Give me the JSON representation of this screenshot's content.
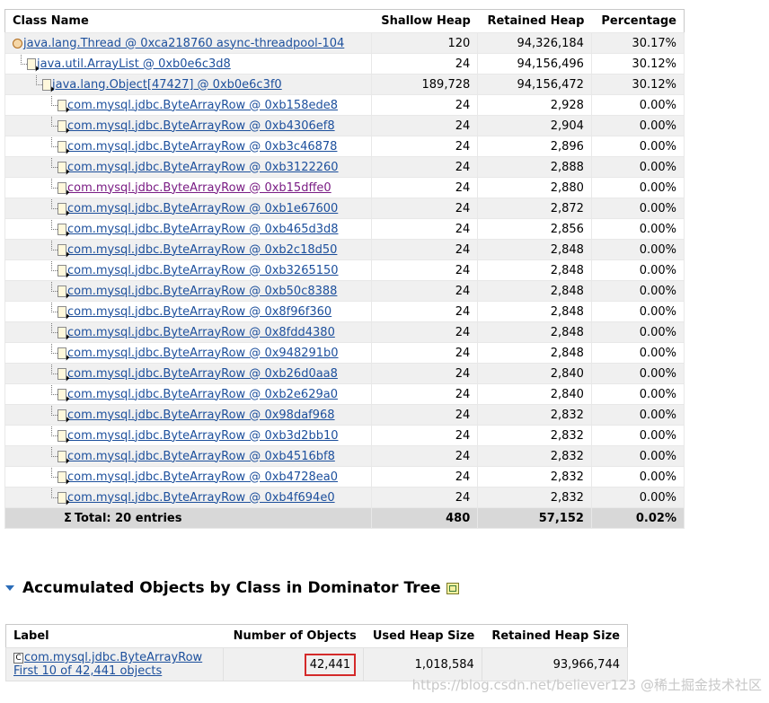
{
  "dominator_table": {
    "columns": [
      "Class Name",
      "Shallow Heap",
      "Retained Heap",
      "Percentage"
    ],
    "rows": [
      {
        "name": "java.lang.Thread @ 0xca218760 async-threadpool-104",
        "shallow": "120",
        "retained": "94,326,184",
        "pct": "30.17%",
        "icon": "thread-icon"
      },
      {
        "name": "java.util.ArrayList @ 0xb0e6c3d8",
        "shallow": "24",
        "retained": "94,156,496",
        "pct": "30.12%",
        "icon": "object-icon"
      },
      {
        "name": "java.lang.Object[47427] @ 0xb0e6c3f0",
        "shallow": "189,728",
        "retained": "94,156,472",
        "pct": "30.12%",
        "icon": "object-icon"
      },
      {
        "name": "com.mysql.jdbc.ByteArrayRow @ 0xb158ede8",
        "shallow": "24",
        "retained": "2,928",
        "pct": "0.00%",
        "icon": "object-icon"
      },
      {
        "name": "com.mysql.jdbc.ByteArrayRow @ 0xb4306ef8",
        "shallow": "24",
        "retained": "2,904",
        "pct": "0.00%",
        "icon": "object-icon"
      },
      {
        "name": "com.mysql.jdbc.ByteArrayRow @ 0xb3c46878",
        "shallow": "24",
        "retained": "2,896",
        "pct": "0.00%",
        "icon": "object-icon"
      },
      {
        "name": "com.mysql.jdbc.ByteArrayRow @ 0xb3122260",
        "shallow": "24",
        "retained": "2,888",
        "pct": "0.00%",
        "icon": "object-icon"
      },
      {
        "name": "com.mysql.jdbc.ByteArrayRow @ 0xb15dffe0",
        "shallow": "24",
        "retained": "2,880",
        "pct": "0.00%",
        "icon": "object-icon"
      },
      {
        "name": "com.mysql.jdbc.ByteArrayRow @ 0xb1e67600",
        "shallow": "24",
        "retained": "2,872",
        "pct": "0.00%",
        "icon": "object-icon"
      },
      {
        "name": "com.mysql.jdbc.ByteArrayRow @ 0xb465d3d8",
        "shallow": "24",
        "retained": "2,856",
        "pct": "0.00%",
        "icon": "object-icon"
      },
      {
        "name": "com.mysql.jdbc.ByteArrayRow @ 0xb2c18d50",
        "shallow": "24",
        "retained": "2,848",
        "pct": "0.00%",
        "icon": "object-icon"
      },
      {
        "name": "com.mysql.jdbc.ByteArrayRow @ 0xb3265150",
        "shallow": "24",
        "retained": "2,848",
        "pct": "0.00%",
        "icon": "object-icon"
      },
      {
        "name": "com.mysql.jdbc.ByteArrayRow @ 0xb50c8388",
        "shallow": "24",
        "retained": "2,848",
        "pct": "0.00%",
        "icon": "object-icon"
      },
      {
        "name": "com.mysql.jdbc.ByteArrayRow @ 0x8f96f360",
        "shallow": "24",
        "retained": "2,848",
        "pct": "0.00%",
        "icon": "object-icon"
      },
      {
        "name": "com.mysql.jdbc.ByteArrayRow @ 0x8fdd4380",
        "shallow": "24",
        "retained": "2,848",
        "pct": "0.00%",
        "icon": "object-icon"
      },
      {
        "name": "com.mysql.jdbc.ByteArrayRow @ 0x948291b0",
        "shallow": "24",
        "retained": "2,848",
        "pct": "0.00%",
        "icon": "object-icon"
      },
      {
        "name": "com.mysql.jdbc.ByteArrayRow @ 0xb26d0aa8",
        "shallow": "24",
        "retained": "2,840",
        "pct": "0.00%",
        "icon": "object-icon"
      },
      {
        "name": "com.mysql.jdbc.ByteArrayRow @ 0xb2e629a0",
        "shallow": "24",
        "retained": "2,840",
        "pct": "0.00%",
        "icon": "object-icon"
      },
      {
        "name": "com.mysql.jdbc.ByteArrayRow @ 0x98daf968",
        "shallow": "24",
        "retained": "2,832",
        "pct": "0.00%",
        "icon": "object-icon"
      },
      {
        "name": "com.mysql.jdbc.ByteArrayRow @ 0xb3d2bb10",
        "shallow": "24",
        "retained": "2,832",
        "pct": "0.00%",
        "icon": "object-icon"
      },
      {
        "name": "com.mysql.jdbc.ByteArrayRow @ 0xb4516bf8",
        "shallow": "24",
        "retained": "2,832",
        "pct": "0.00%",
        "icon": "object-icon"
      },
      {
        "name": "com.mysql.jdbc.ByteArrayRow @ 0xb4728ea0",
        "shallow": "24",
        "retained": "2,832",
        "pct": "0.00%",
        "icon": "object-icon"
      },
      {
        "name": "com.mysql.jdbc.ByteArrayRow @ 0xb4f694e0",
        "shallow": "24",
        "retained": "2,832",
        "pct": "0.00%",
        "icon": "object-icon"
      }
    ],
    "total": {
      "symbol": "Σ",
      "label": "Total: 20 entries",
      "shallow": "480",
      "retained": "57,152",
      "pct": "0.02%"
    }
  },
  "accumulated_section": {
    "title": "Accumulated Objects by Class in Dominator Tree",
    "columns": [
      "Label",
      "Number of Objects",
      "Used Heap Size",
      "Retained Heap Size"
    ],
    "row": {
      "class_icon_glyph": "C",
      "class_name": "com.mysql.jdbc.ByteArrayRow",
      "link": "First 10 of 42,441 objects",
      "num_objects": "42,441",
      "used_heap": "1,018,584",
      "retained_heap": "93,966,744"
    }
  },
  "watermark": "https://blog.csdn.net/believer123 @稀土掘金技术社区",
  "colors": {
    "link": "#1c4f9c",
    "visited_link": "#7a1c84",
    "row_alt": "#f0f0f0",
    "total_row": "#d8d8d8",
    "highlight": "#d42a2a"
  }
}
